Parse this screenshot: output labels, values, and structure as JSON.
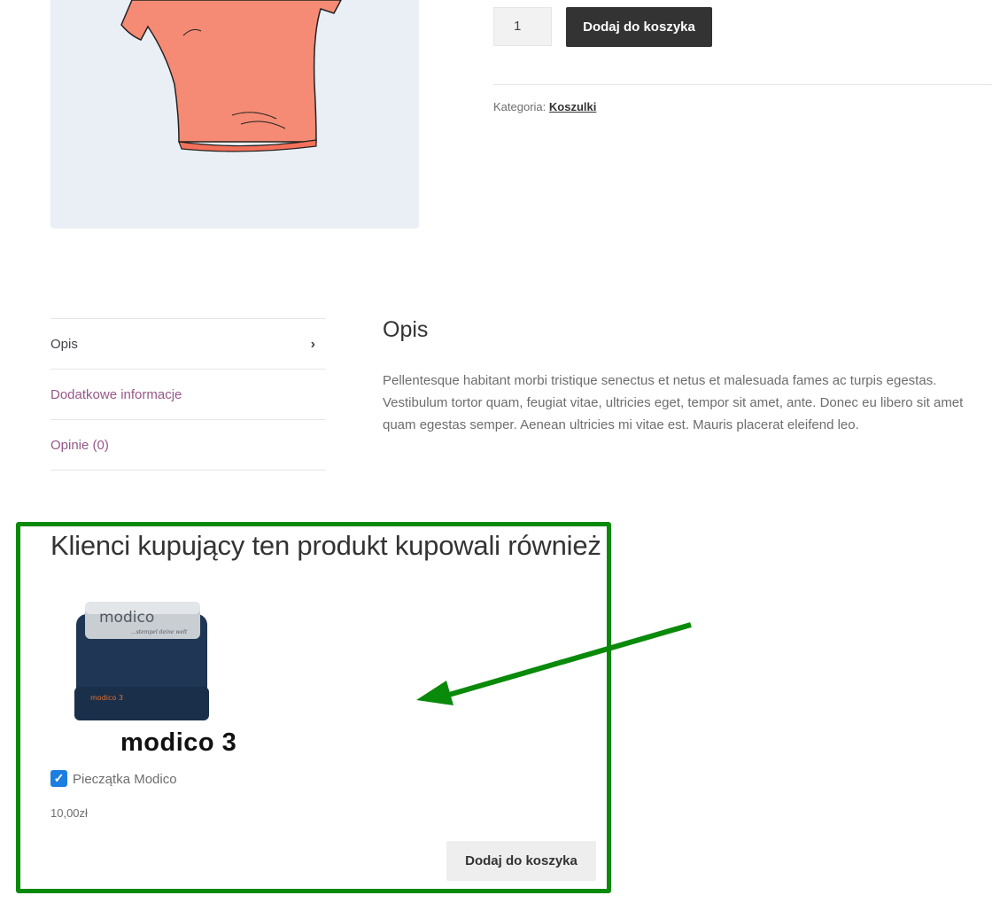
{
  "product": {
    "quantity": "1",
    "add_to_cart_label": "Dodaj do koszyka",
    "category_label": "Kategoria:",
    "category_value": "Koszulki"
  },
  "tabs": [
    {
      "label": "Opis"
    },
    {
      "label": "Dodatkowe informacje"
    },
    {
      "label": "Opinie (0)"
    }
  ],
  "description": {
    "heading": "Opis",
    "text": "Pellentesque habitant morbi tristique senectus et netus et malesuada fames ac turpis egestas. Vestibulum tortor quam, feugiat vitae, ultricies eget, tempor sit amet, ante. Donec eu libero sit amet quam egestas semper. Aenean ultricies mi vitae est. Mauris placerat eleifend leo."
  },
  "upsell": {
    "heading": "Klienci kupujący ten produkt kupowali również",
    "item_image_text": "modico",
    "item_image_tagline": "...stempel deine welt",
    "item_image_model": "modico 3",
    "item_brand_caption": "modico 3",
    "item_name": "Pieczątka Modico",
    "item_checked": true,
    "item_price": "10,00zł",
    "add_to_cart_label": "Dodaj do koszyka"
  },
  "colors": {
    "highlight_border": "#0a8a0a",
    "link": "#96588a",
    "dark_button": "#333333",
    "checkbox": "#1b7ee0"
  }
}
